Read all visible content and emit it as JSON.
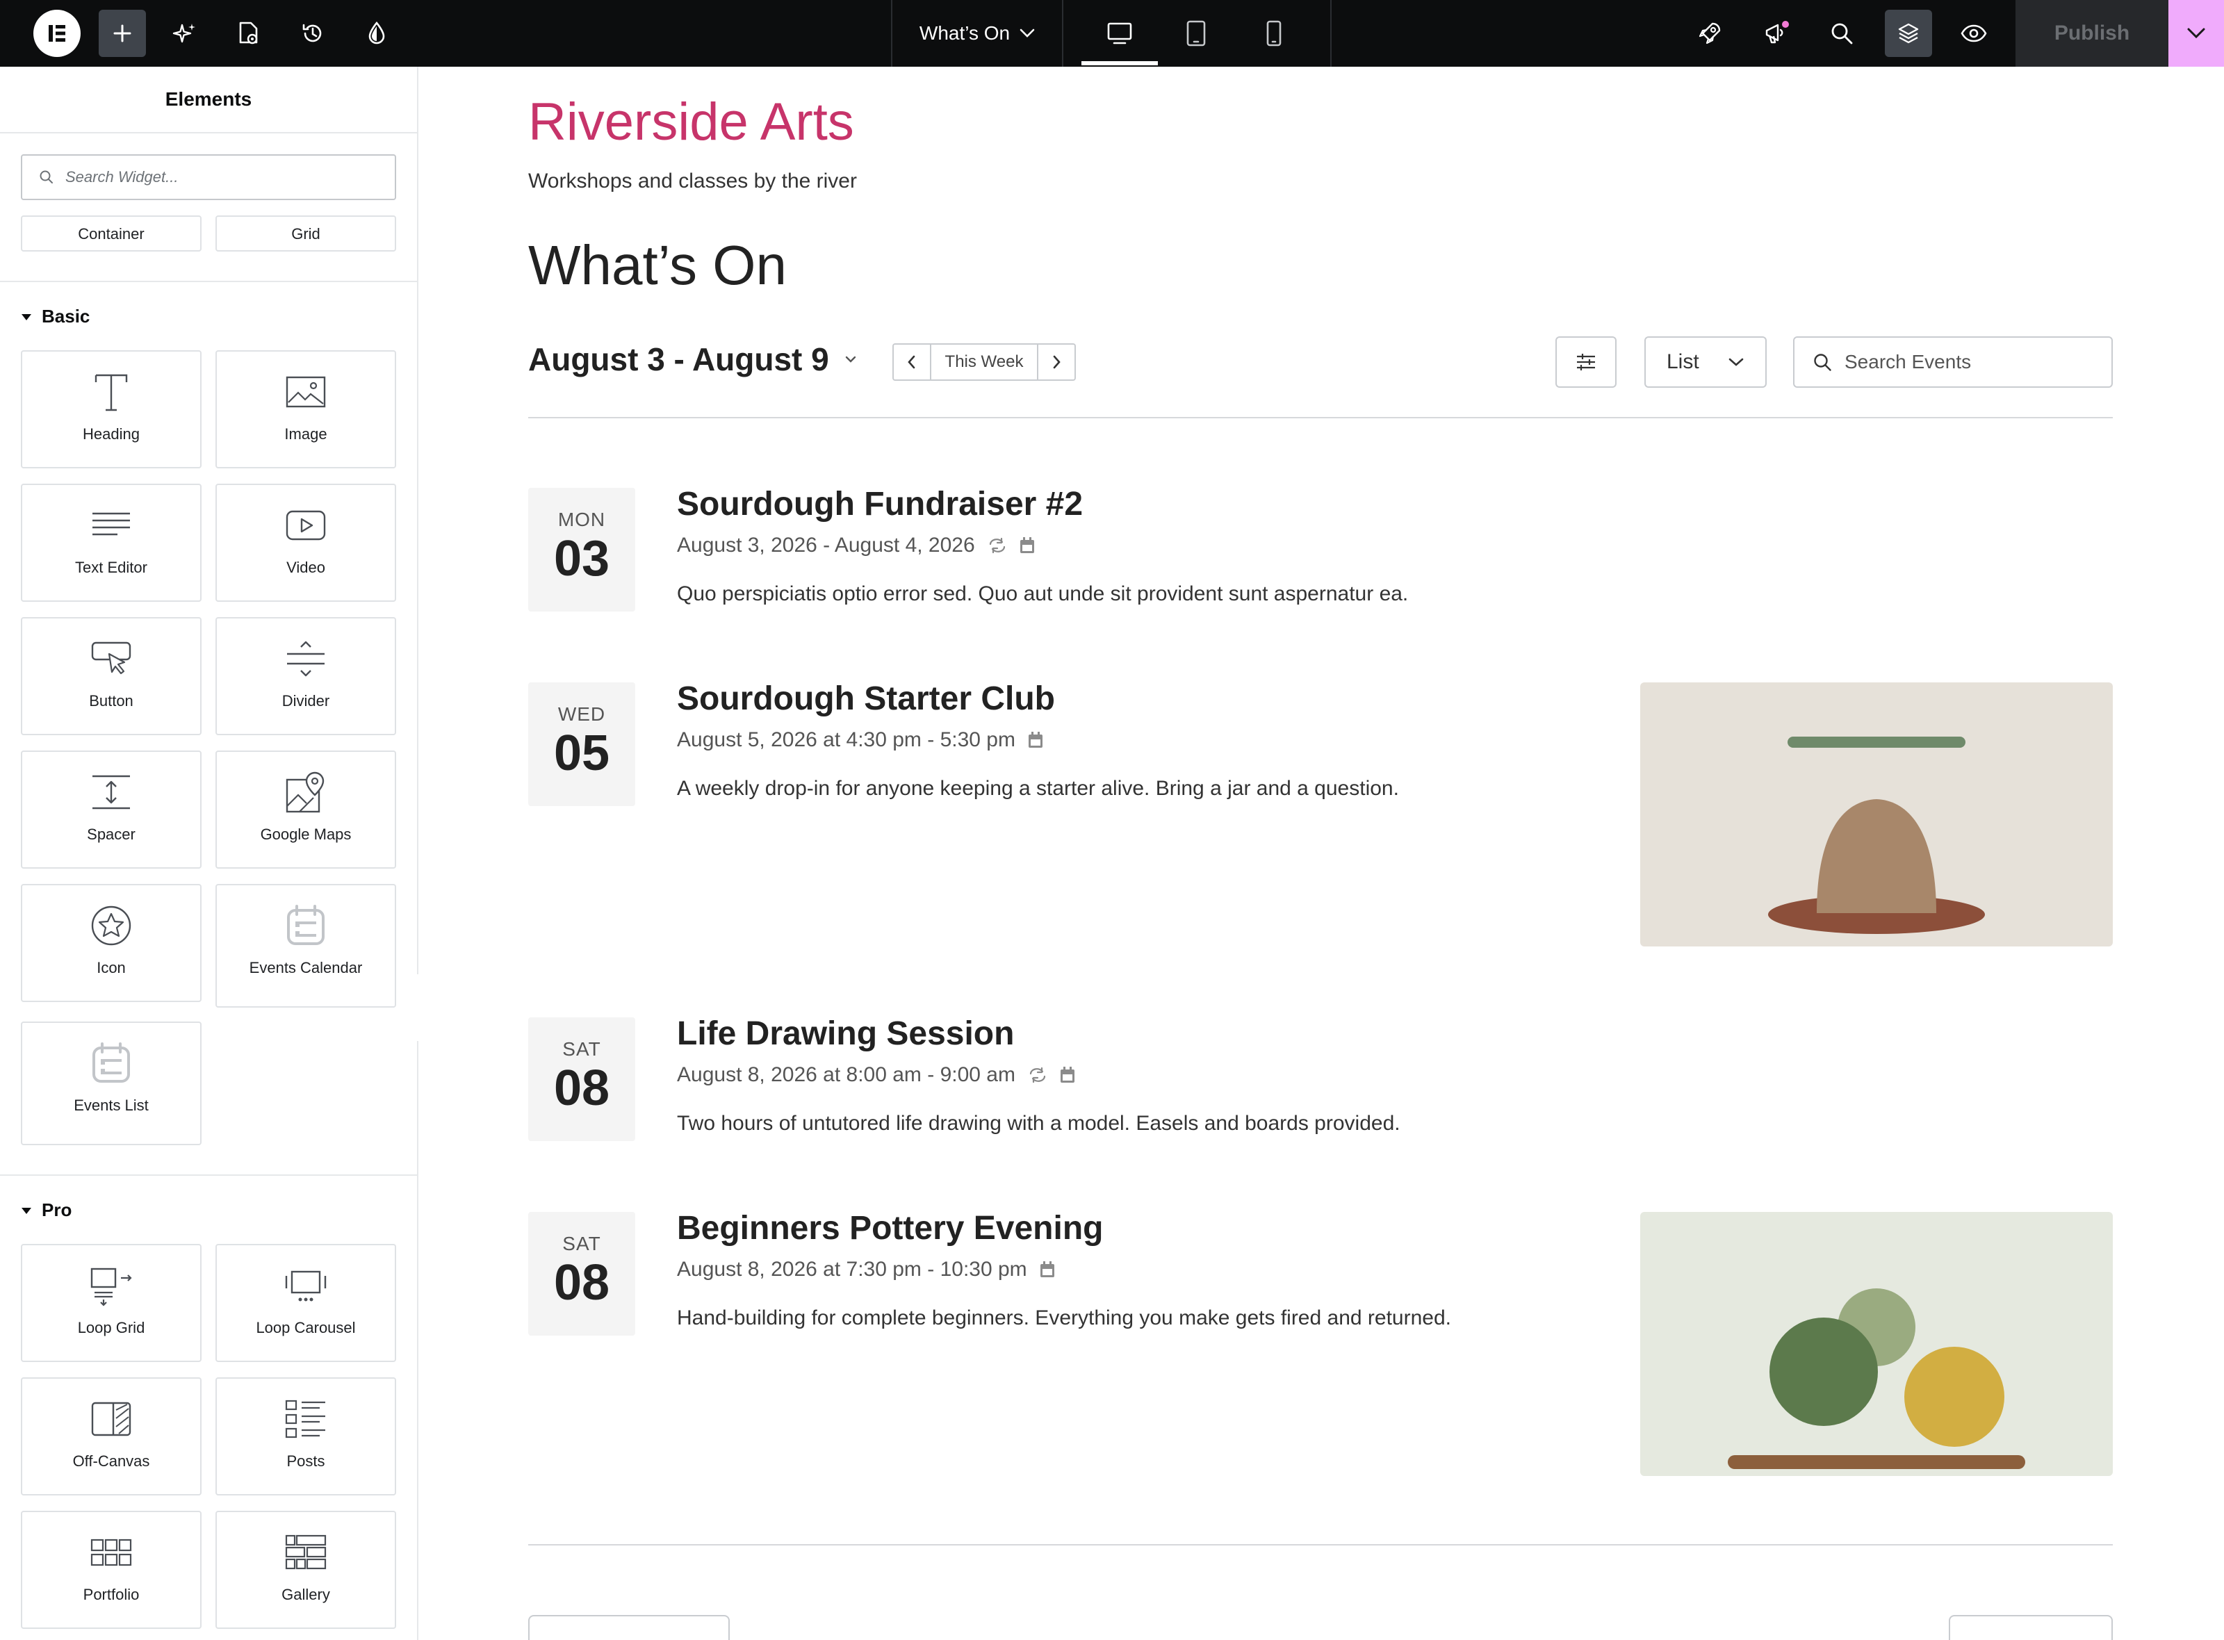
{
  "topbar": {
    "page_name": "What’s On",
    "publish_label": "Publish",
    "icons": [
      "elementor-logo-icon",
      "add-element-icon",
      "ai-sparkle-icon",
      "page-settings-icon",
      "history-icon",
      "site-settings-icon",
      "desktop-icon",
      "tablet-icon",
      "mobile-icon",
      "rocket-icon",
      "notifications-icon",
      "finder-search-icon",
      "structure-layers-icon",
      "preview-eye-icon"
    ],
    "accent_color": "#f0abfc"
  },
  "panel": {
    "title": "Elements",
    "search_placeholder": "Search Widget...",
    "layout_partial": [
      "Container",
      "Grid"
    ],
    "basic": {
      "label": "Basic",
      "widgets": [
        "Heading",
        "Image",
        "Text Editor",
        "Video",
        "Button",
        "Divider",
        "Spacer",
        "Google Maps",
        "Icon",
        "Events Calendar",
        "Events List"
      ]
    },
    "pro": {
      "label": "Pro",
      "widgets": [
        "Loop Grid",
        "Loop Carousel",
        "Off-Canvas",
        "Posts",
        "Portfolio",
        "Gallery"
      ]
    }
  },
  "site": {
    "title": "Riverside Arts",
    "tagline": "Workshops and classes by the river",
    "title_color": "#c7346a"
  },
  "page": {
    "heading": "What’s On",
    "date_range": "August 3 - August 9",
    "this_week_label": "This Week",
    "view_select": "List",
    "search_placeholder": "Search Events"
  },
  "events": [
    {
      "dow": "MON",
      "day": "03",
      "title": "Sourdough Fundraiser #2",
      "meta": "August 3, 2026 - August 4, 2026",
      "recurring": true,
      "desc": "Quo perspiciatis optio error sed. Quo aut unde sit provident sunt aspernatur ea.",
      "image": false
    },
    {
      "dow": "WED",
      "day": "05",
      "title": "Sourdough Starter Club",
      "meta": "August 5, 2026 at 4:30 pm - 5:30 pm",
      "recurring": false,
      "desc": "A weekly drop-in for anyone keeping a starter alive. Bring a jar and a question.",
      "image": true
    },
    {
      "dow": "SAT",
      "day": "08",
      "title": "Life Drawing Session",
      "meta": "August 8, 2026 at 8:00 am - 9:00 am",
      "recurring": true,
      "desc": "Two hours of untutored life drawing with a model. Easels and boards provided.",
      "image": false
    },
    {
      "dow": "SAT",
      "day": "08",
      "title": "Beginners Pottery Evening",
      "meta": "August 8, 2026 at 7:30 pm - 10:30 pm",
      "recurring": false,
      "desc": "Hand-building for complete beginners. Everything you make gets fired and returned.",
      "image": true
    }
  ]
}
